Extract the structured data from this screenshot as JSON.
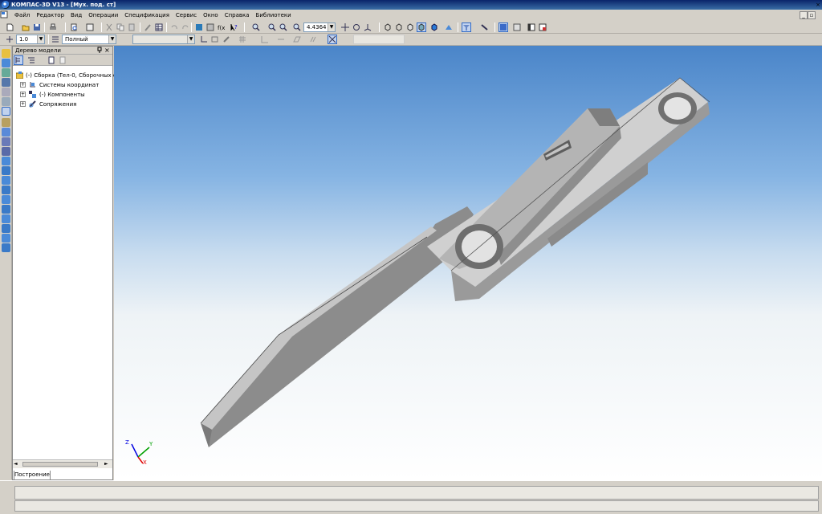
{
  "app": {
    "title": "КОМПАС-3D V13 - [Мух. под. ст]",
    "window_controls": [
      "_",
      "▫",
      "×"
    ]
  },
  "menu": [
    "Файл",
    "Редактор",
    "Вид",
    "Операции",
    "Спецификация",
    "Сервис",
    "Окно",
    "Справка",
    "Библиотеки"
  ],
  "toolbar": {
    "zoom_value": "4.4364"
  },
  "view_toolbar": {
    "step_value": "1.0",
    "style_value": "Полный",
    "layer_value": ""
  },
  "tree": {
    "panel_title": "Дерево модели",
    "pin_icon": "pin-icon",
    "close_icon": "close-icon",
    "root_label": "(-) Сборка (Тел-0, Сборочных е",
    "items": [
      {
        "label": "Системы координат",
        "icon": "coordinate-systems-icon"
      },
      {
        "label": "(-) Компоненты",
        "icon": "components-icon"
      },
      {
        "label": "Сопряжения",
        "icon": "constraints-icon"
      }
    ],
    "tab_label": "Построение"
  },
  "axes": {
    "x": "X",
    "y": "Y",
    "z": "Z"
  },
  "colors": {
    "title_bar": "#0a246a",
    "part_top": "#c8c8c8",
    "part_side": "#8a8a8a",
    "axis_x": "#e00000",
    "axis_y": "#00a000",
    "axis_z": "#0000e0"
  }
}
